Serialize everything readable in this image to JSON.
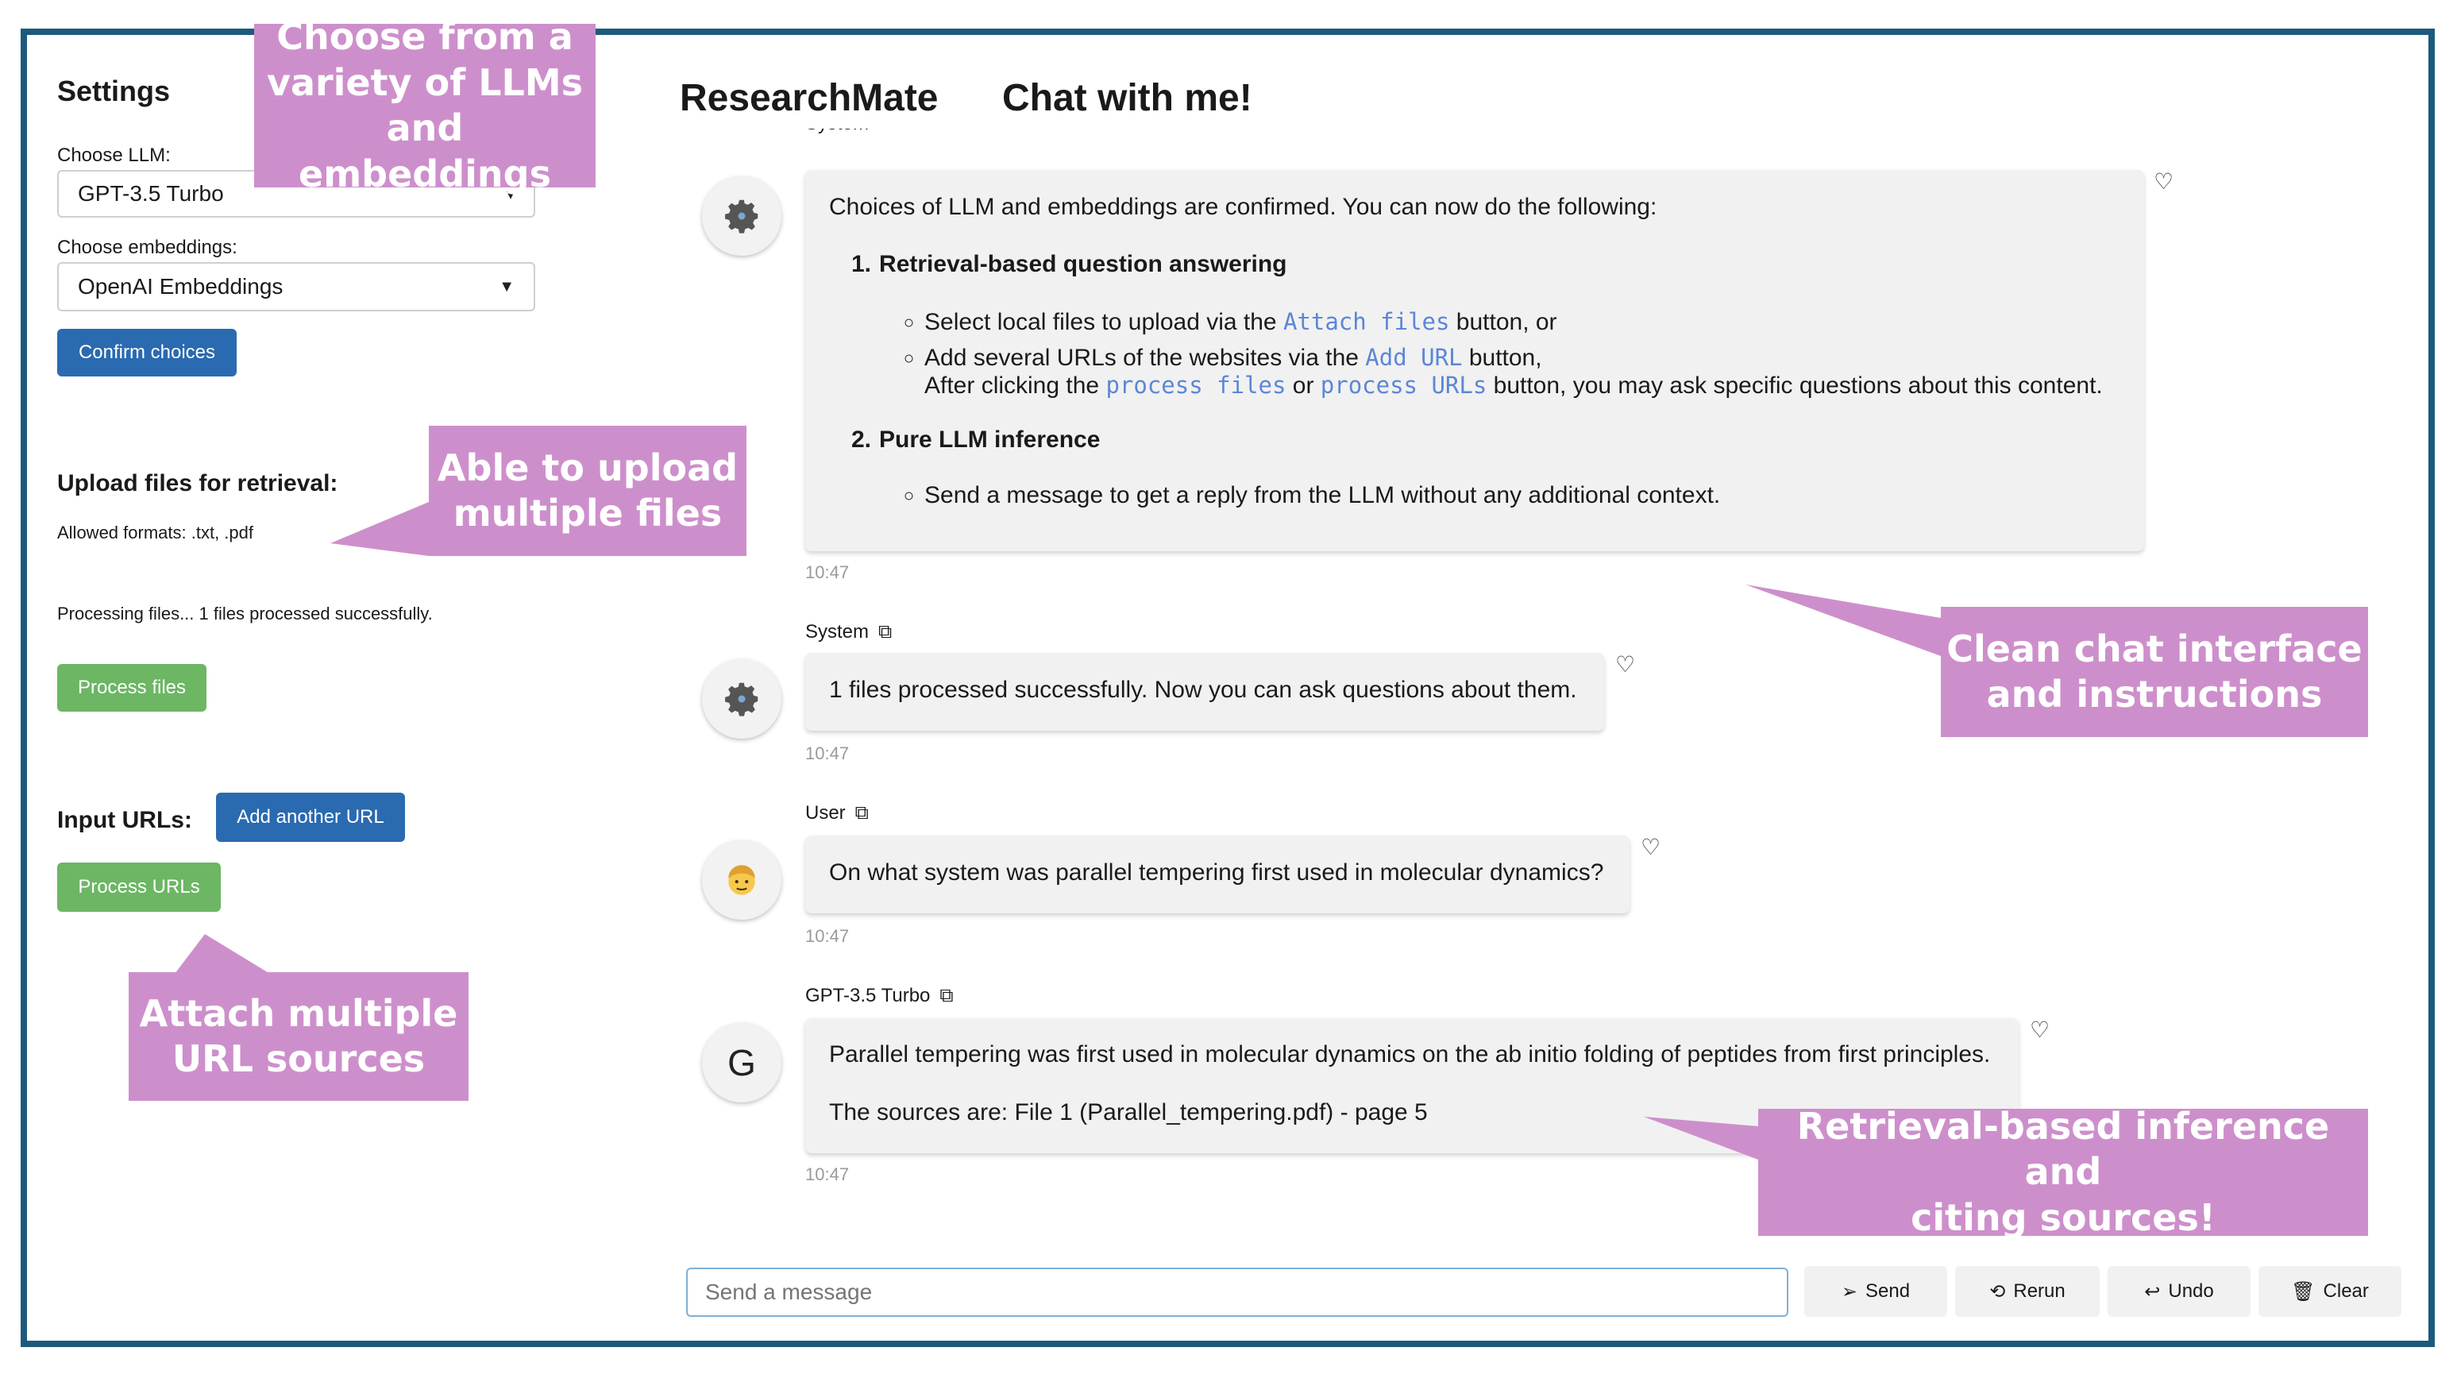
{
  "settings": {
    "title": "Settings",
    "choose_llm_label": "Choose LLM:",
    "llm_value": "GPT-3.5 Turbo",
    "choose_emb_label": "Choose embeddings:",
    "emb_value": "OpenAI Embeddings",
    "confirm_label": "Confirm choices",
    "upload_heading": "Upload files for retrieval:",
    "allowed_formats": "Allowed formats: .txt, .pdf",
    "processing_status": "Processing files... 1 files processed successfully.",
    "process_files_label": "Process files",
    "input_urls_label": "Input URLs:",
    "add_url_label": "Add another URL",
    "process_urls_label": "Process URLs"
  },
  "header": {
    "app_title": "ResearchMate",
    "chat_title": "Chat with me!"
  },
  "chat": {
    "cut_sender": "System",
    "msg1": {
      "intro": "Choices of LLM and embeddings are confirmed. You can now do the following:",
      "n1": "1.",
      "item1_title": "Retrieval-based question answering",
      "sub1_a_pre": "Select local files to upload via the ",
      "sub1_a_code": "Attach files",
      "sub1_a_post": " button, or",
      "sub1_b_pre": "Add several URLs of the websites via the ",
      "sub1_b_code": "Add URL",
      "sub1_b_post": " button,",
      "sub1_c_pre": "After clicking the ",
      "sub1_c_code1": "process files",
      "sub1_c_mid": " or ",
      "sub1_c_code2": "process URLs",
      "sub1_c_post": " button, you may ask specific questions about this content.",
      "n2": "2.",
      "item2_title": "Pure LLM inference",
      "sub2_a": "Send a message to get a reply from the LLM without any additional context.",
      "time": "10:47"
    },
    "msg2": {
      "sender": "System",
      "text": "1 files processed successfully. Now you can ask questions about them.",
      "time": "10:47"
    },
    "msg3": {
      "sender": "User",
      "text": "On what system was parallel tempering first used in molecular dynamics?",
      "time": "10:47"
    },
    "msg4": {
      "sender": "GPT-3.5 Turbo",
      "avatar_letter": "G",
      "text": "Parallel tempering was first used in molecular dynamics on the ab initio folding of peptides from first principles.",
      "sources": "The sources are: File 1 (Parallel_tempering.pdf) - page 5",
      "time": "10:47"
    }
  },
  "input_bar": {
    "placeholder": "Send a message",
    "send_label": "Send",
    "rerun_label": "Rerun",
    "undo_label": "Undo",
    "clear_label": "Clear"
  },
  "annotations": {
    "llm_line1": "Choose from a",
    "llm_line2": "variety of LLMs",
    "llm_line3": "and embeddings",
    "upload_line1": "Able to upload",
    "upload_line2": "multiple files",
    "url_line1": "Attach multiple",
    "url_line2": "URL sources",
    "chat_line1": "Clean chat interface",
    "chat_line2": "and instructions",
    "retr_line1": "Retrieval-based inference and",
    "retr_line2": "citing sources!"
  },
  "colors": {
    "frame": "#1c5a7d",
    "annotation": "#cd8fcb",
    "primary_button": "#2a6ab0",
    "success_button": "#6cb664",
    "code_text": "#5c86d6"
  },
  "icons": [
    "gear-icon",
    "user-face-icon",
    "copy-icon",
    "heart-icon",
    "send-icon",
    "rerun-icon",
    "undo-icon",
    "trash-icon",
    "dropdown-caret-icon"
  ]
}
